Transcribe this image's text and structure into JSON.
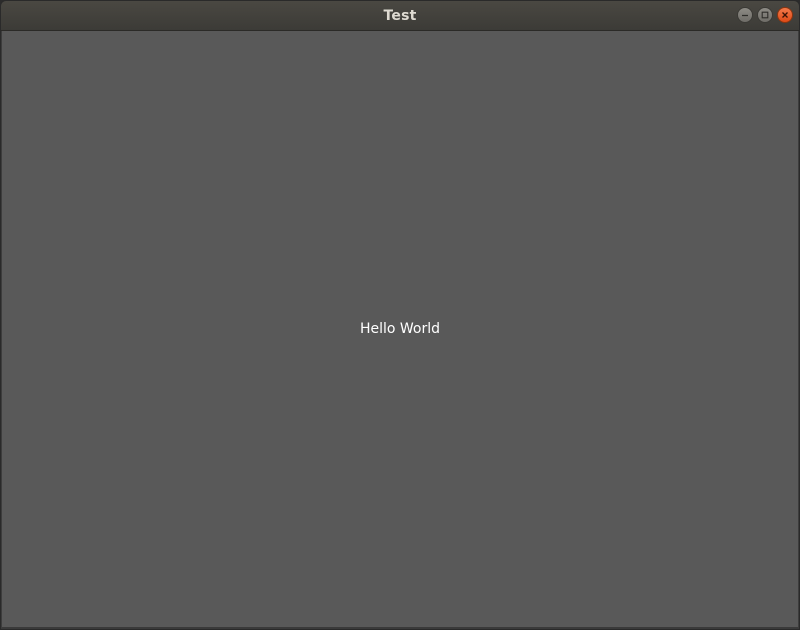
{
  "window": {
    "title": "Test",
    "controls": {
      "minimize_icon": "minimize-icon",
      "maximize_icon": "maximize-icon",
      "close_icon": "close-icon"
    }
  },
  "content": {
    "label": "Hello World"
  },
  "colors": {
    "titlebar": "#3c3b37",
    "content_bg": "#595959",
    "close_button": "#e9541f",
    "text": "#ffffff"
  }
}
